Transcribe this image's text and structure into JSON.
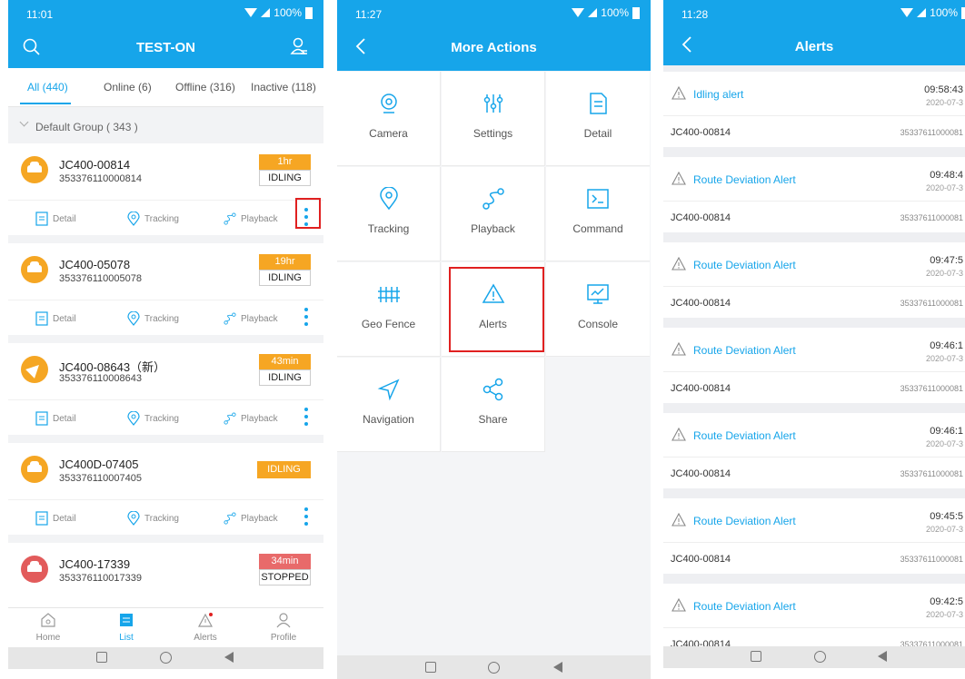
{
  "panel1": {
    "status_time": "11:01",
    "battery": "100%",
    "title": "TEST-ON",
    "tabs": [
      {
        "label": "All (440)"
      },
      {
        "label": "Online (6)"
      },
      {
        "label": "Offline (316)"
      },
      {
        "label": "Inactive (118)"
      }
    ],
    "group": "Default Group ( 343 )",
    "actions": {
      "detail": "Detail",
      "tracking": "Tracking",
      "playback": "Playback"
    },
    "vehicles": [
      {
        "name": "JC400-00814",
        "imei": "353376110000814",
        "time": "1hr",
        "status": "IDLING"
      },
      {
        "name": "JC400-05078",
        "imei": "353376110005078",
        "time": "19hr",
        "status": "IDLING"
      },
      {
        "name": "JC400-08643（新）",
        "imei": "353376110008643",
        "time": "43min",
        "status": "IDLING"
      },
      {
        "name": "JC400D-07405",
        "imei": "353376110007405",
        "time": "",
        "status": "IDLING"
      },
      {
        "name": "JC400-17339",
        "imei": "353376110017339",
        "time": "34min",
        "status": "STOPPED"
      }
    ],
    "nav": [
      {
        "label": "Home"
      },
      {
        "label": "List"
      },
      {
        "label": "Alerts"
      },
      {
        "label": "Profile"
      }
    ]
  },
  "panel2": {
    "status_time": "11:27",
    "battery": "100%",
    "title": "More Actions",
    "items": [
      {
        "label": "Camera",
        "icon": "camera-icon"
      },
      {
        "label": "Settings",
        "icon": "settings-icon"
      },
      {
        "label": "Detail",
        "icon": "detail-icon"
      },
      {
        "label": "Tracking",
        "icon": "tracking-icon"
      },
      {
        "label": "Playback",
        "icon": "playback-icon"
      },
      {
        "label": "Command",
        "icon": "command-icon"
      },
      {
        "label": "Geo Fence",
        "icon": "geofence-icon"
      },
      {
        "label": "Alerts",
        "icon": "alert-icon"
      },
      {
        "label": "Console",
        "icon": "console-icon"
      },
      {
        "label": "Navigation",
        "icon": "navigation-icon"
      },
      {
        "label": "Share",
        "icon": "share-icon"
      }
    ]
  },
  "panel3": {
    "status_time": "11:28",
    "battery": "100%",
    "title": "Alerts",
    "alerts": [
      {
        "type": "Idling alert",
        "time": "09:58:43",
        "date": "2020-07-3",
        "device": "JC400-00814",
        "imei": "35337611000081"
      },
      {
        "type": "Route Deviation Alert",
        "time": "09:48:4",
        "date": "2020-07-3",
        "device": "JC400-00814",
        "imei": "35337611000081"
      },
      {
        "type": "Route Deviation Alert",
        "time": "09:47:5",
        "date": "2020-07-3",
        "device": "JC400-00814",
        "imei": "35337611000081"
      },
      {
        "type": "Route Deviation Alert",
        "time": "09:46:1",
        "date": "2020-07-3",
        "device": "JC400-00814",
        "imei": "35337611000081"
      },
      {
        "type": "Route Deviation Alert",
        "time": "09:46:1",
        "date": "2020-07-3",
        "device": "JC400-00814",
        "imei": "35337611000081"
      },
      {
        "type": "Route Deviation Alert",
        "time": "09:45:5",
        "date": "2020-07-3",
        "device": "JC400-00814",
        "imei": "35337611000081"
      },
      {
        "type": "Route Deviation Alert",
        "time": "09:42:5",
        "date": "2020-07-3",
        "device": "JC400-00814",
        "imei": "35337611000081"
      }
    ]
  },
  "colors": {
    "primary": "#16a5ea",
    "warning": "#f6a623",
    "danger": "#e86a6a",
    "highlight": "#e02020"
  }
}
